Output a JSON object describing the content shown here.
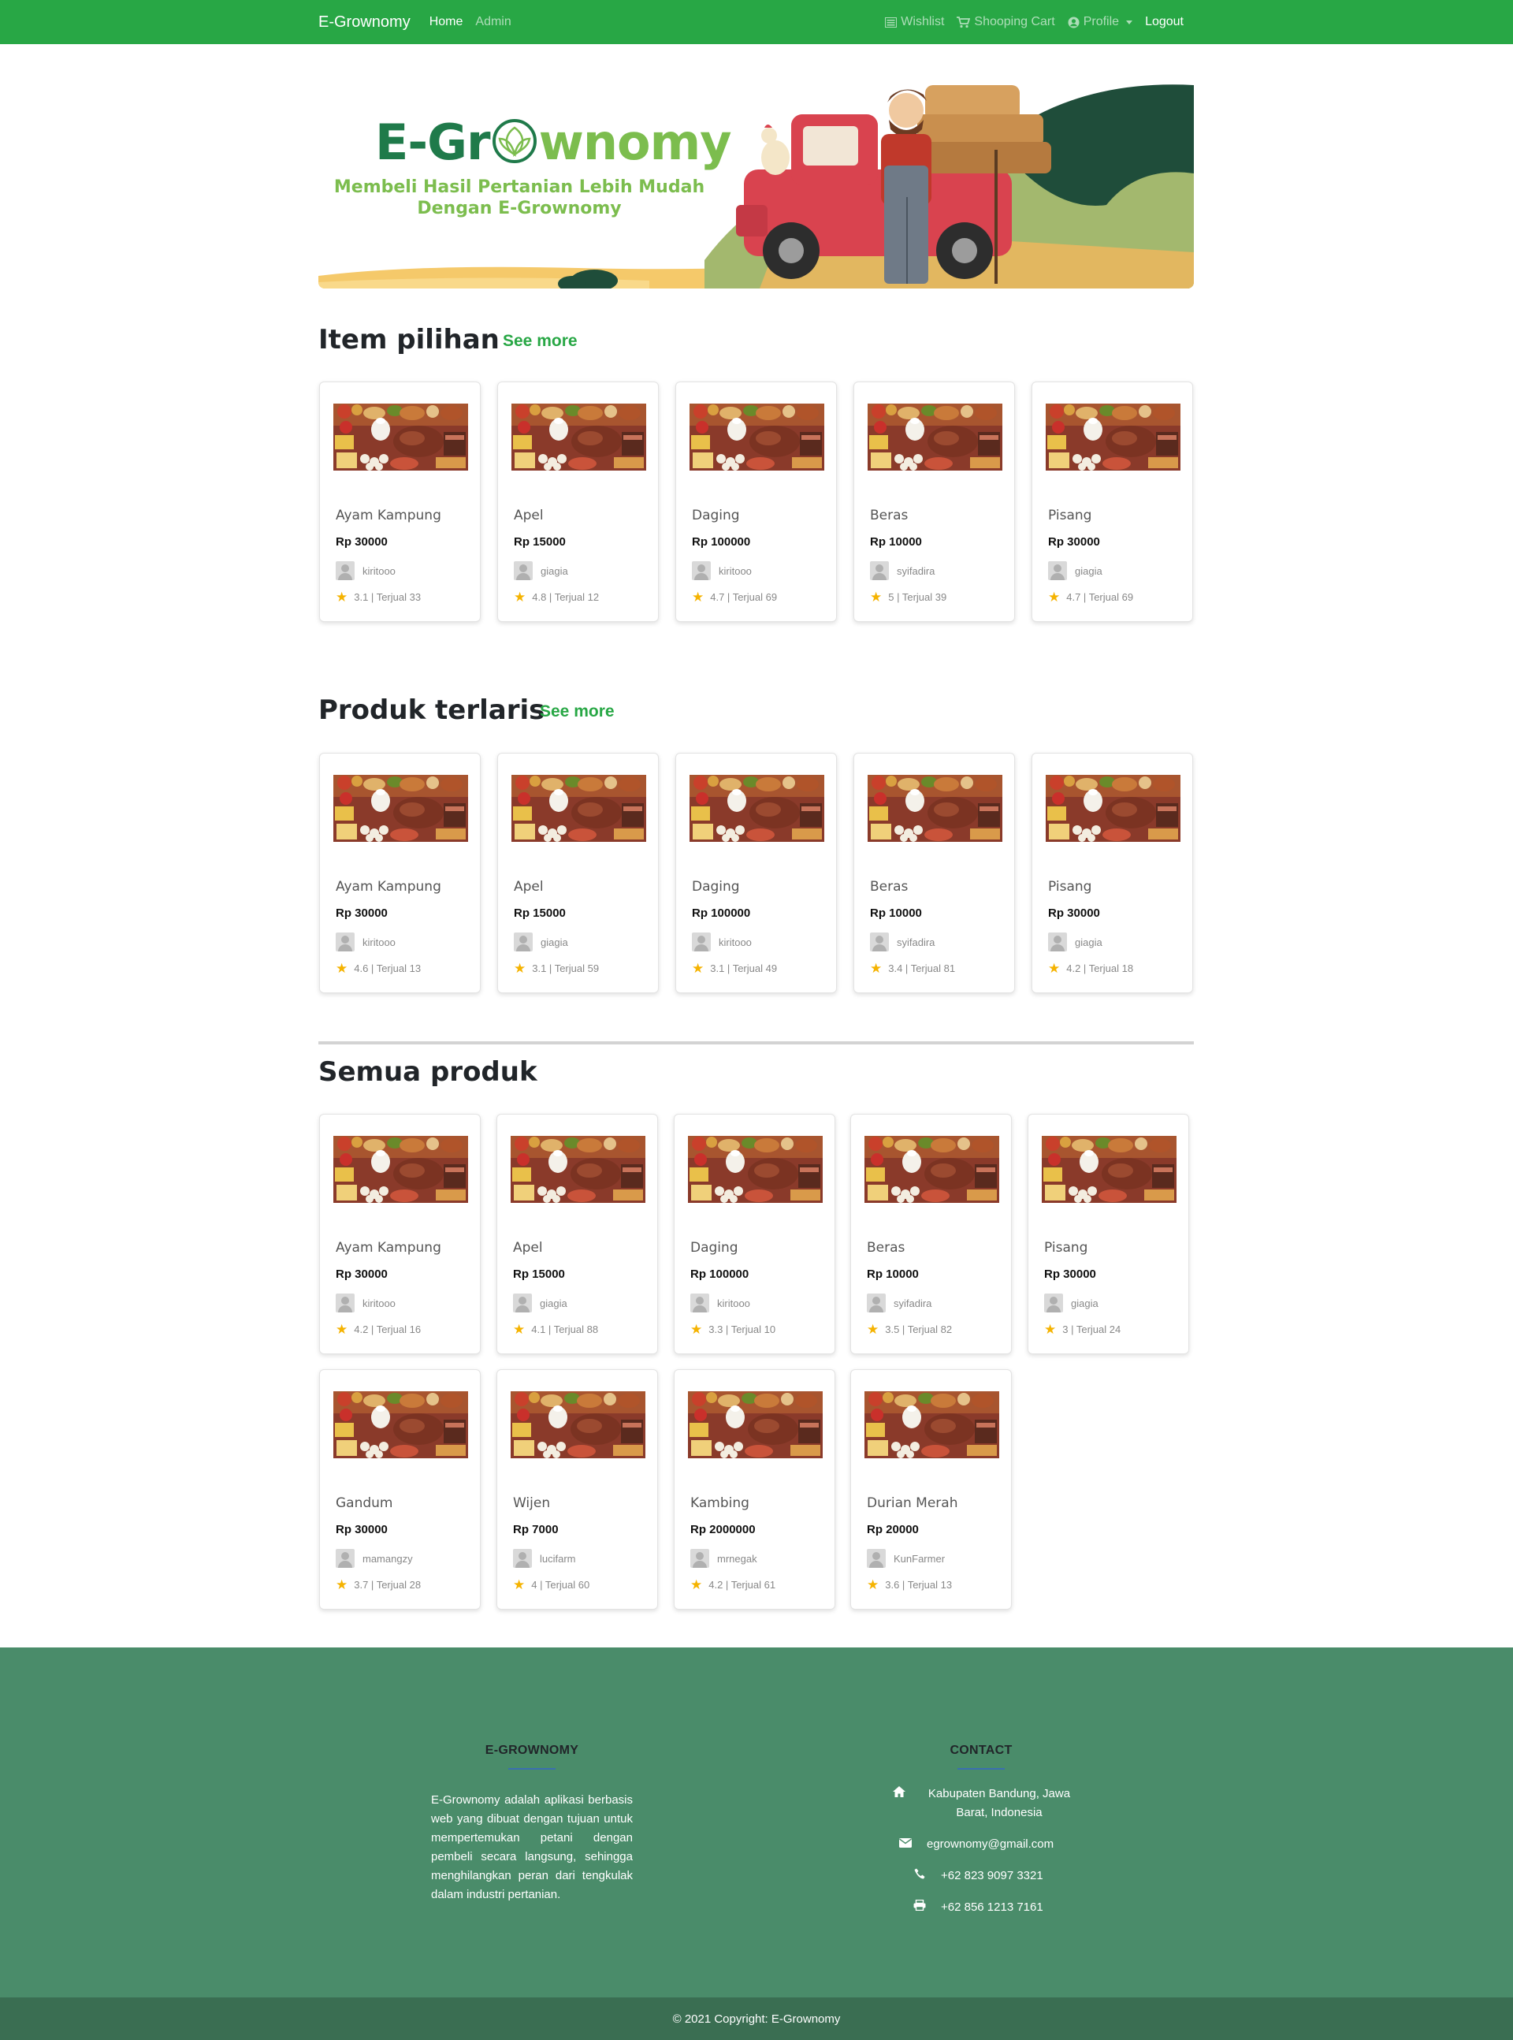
{
  "nav": {
    "brand": "E-Grownomy",
    "home": "Home",
    "admin": "Admin",
    "wishlist": "Wishlist",
    "cart": "Shooping Cart",
    "profile": "Profile",
    "logout": "Logout"
  },
  "banner": {
    "title_left": "E-Gr",
    "title_right": "wnomy",
    "tagline_1": "Membeli Hasil Pertanian Lebih Mudah",
    "tagline_2": "Dengan E-Grownomy"
  },
  "sections": {
    "pilihan": {
      "title": "Item pilihan",
      "see_more": "See more"
    },
    "terlaris": {
      "title": "Produk terlaris",
      "see_more": "See more"
    },
    "semua": {
      "title": "Semua produk"
    }
  },
  "pilihan": [
    {
      "name": "Ayam Kampung",
      "price": "Rp 30000",
      "seller": "kiritooo",
      "rating": "3.1 | Terjual 33"
    },
    {
      "name": "Apel",
      "price": "Rp 15000",
      "seller": "giagia",
      "rating": "4.8 | Terjual 12"
    },
    {
      "name": "Daging",
      "price": "Rp 100000",
      "seller": "kiritooo",
      "rating": "4.7 | Terjual 69"
    },
    {
      "name": "Beras",
      "price": "Rp 10000",
      "seller": "syifadira",
      "rating": "5 | Terjual 39"
    },
    {
      "name": "Pisang",
      "price": "Rp 30000",
      "seller": "giagia",
      "rating": "4.7 | Terjual 69"
    }
  ],
  "terlaris": [
    {
      "name": "Ayam Kampung",
      "price": "Rp 30000",
      "seller": "kiritooo",
      "rating": "4.6 | Terjual 13"
    },
    {
      "name": "Apel",
      "price": "Rp 15000",
      "seller": "giagia",
      "rating": "3.1 | Terjual 59"
    },
    {
      "name": "Daging",
      "price": "Rp 100000",
      "seller": "kiritooo",
      "rating": "3.1 | Terjual 49"
    },
    {
      "name": "Beras",
      "price": "Rp 10000",
      "seller": "syifadira",
      "rating": "3.4 | Terjual 81"
    },
    {
      "name": "Pisang",
      "price": "Rp 30000",
      "seller": "giagia",
      "rating": "4.2 | Terjual 18"
    }
  ],
  "semua": [
    {
      "name": "Ayam Kampung",
      "price": "Rp 30000",
      "seller": "kiritooo",
      "rating": "4.2 | Terjual 16"
    },
    {
      "name": "Apel",
      "price": "Rp 15000",
      "seller": "giagia",
      "rating": "4.1 | Terjual 88"
    },
    {
      "name": "Daging",
      "price": "Rp 100000",
      "seller": "kiritooo",
      "rating": "3.3 | Terjual 10"
    },
    {
      "name": "Beras",
      "price": "Rp 10000",
      "seller": "syifadira",
      "rating": "3.5 | Terjual 82"
    },
    {
      "name": "Pisang",
      "price": "Rp 30000",
      "seller": "giagia",
      "rating": "3 | Terjual 24"
    },
    {
      "name": "Gandum",
      "price": "Rp 30000",
      "seller": "mamangzy",
      "rating": "3.7 | Terjual 28"
    },
    {
      "name": "Wijen",
      "price": "Rp 7000",
      "seller": "lucifarm",
      "rating": "4 | Terjual 60"
    },
    {
      "name": "Kambing",
      "price": "Rp 2000000",
      "seller": "mrnegak",
      "rating": "4.2 | Terjual 61"
    },
    {
      "name": "Durian Merah",
      "price": "Rp 20000",
      "seller": "KunFarmer",
      "rating": "3.6 | Terjual 13"
    }
  ],
  "footer": {
    "about_title": "E-GROWNOMY",
    "about_text": "E-Grownomy adalah aplikasi berbasis web yang dibuat dengan tujuan untuk mempertemukan petani dengan pembeli secara langsung, sehingga menghilangkan peran dari tengkulak dalam industri pertanian.",
    "contact_title": "CONTACT",
    "address": "Kabupaten Bandung, Jawa Barat, Indonesia",
    "email": "egrownomy@gmail.com",
    "phone": "+62 823 9097 3321",
    "fax": "+62 856 1213 7161",
    "copyright": "© 2021 Copyright: E-Grownomy"
  }
}
